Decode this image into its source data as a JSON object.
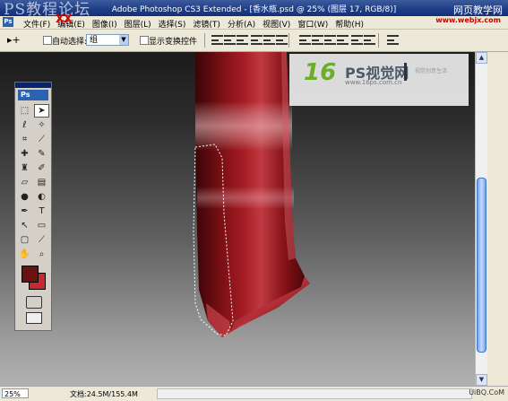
{
  "window": {
    "title": "Adobe Photoshop CS3 Extended - [香水瓶.psd @ 25% (图层 17, RGB/8)]",
    "watermark_left": "PS教程论坛",
    "watermark_right": "网页教学网",
    "minimize": "_",
    "restore": "❐",
    "close": "✕"
  },
  "menubar": {
    "items": [
      "文件(F)",
      "编辑(E)",
      "图像(I)",
      "图层(L)",
      "选择(S)",
      "滤镜(T)",
      "分析(A)",
      "视图(V)",
      "窗口(W)",
      "帮助(H)"
    ],
    "site": "www.webjx.com",
    "mark": "XX"
  },
  "options": {
    "tool_glyph": "▸+",
    "auto_select_label": "自动选择:",
    "auto_select_value": "组",
    "show_transform_label": "显示变换控件"
  },
  "logo": {
    "number": "16",
    "name": "PS视觉网",
    "url": "www.16ps.com.cn",
    "small": "视觉创意生活"
  },
  "tools": {
    "palette_label": "Ps",
    "items": [
      {
        "name": "marquee-icon",
        "glyph": "⬚"
      },
      {
        "name": "move-icon",
        "glyph": "➤"
      },
      {
        "name": "lasso-icon",
        "glyph": "ℓ"
      },
      {
        "name": "magic-wand-icon",
        "glyph": "✧"
      },
      {
        "name": "crop-icon",
        "glyph": "⌗"
      },
      {
        "name": "slice-icon",
        "glyph": "⟋"
      },
      {
        "name": "healing-icon",
        "glyph": "✚"
      },
      {
        "name": "brush-icon",
        "glyph": "✎"
      },
      {
        "name": "stamp-icon",
        "glyph": "♜"
      },
      {
        "name": "history-brush-icon",
        "glyph": "✐"
      },
      {
        "name": "eraser-icon",
        "glyph": "▱"
      },
      {
        "name": "gradient-icon",
        "glyph": "▤"
      },
      {
        "name": "blur-icon",
        "glyph": "●"
      },
      {
        "name": "dodge-icon",
        "glyph": "◐"
      },
      {
        "name": "pen-icon",
        "glyph": "✒"
      },
      {
        "name": "type-icon",
        "glyph": "T"
      },
      {
        "name": "path-select-icon",
        "glyph": "↖"
      },
      {
        "name": "shape-icon",
        "glyph": "▭"
      },
      {
        "name": "notes-icon",
        "glyph": "▢"
      },
      {
        "name": "eyedropper-icon",
        "glyph": "⟋"
      },
      {
        "name": "hand-icon",
        "glyph": "✋"
      },
      {
        "name": "zoom-icon",
        "glyph": "⌕"
      }
    ]
  },
  "colors": {
    "foreground": "#6a1313",
    "background": "#c8292c"
  },
  "status": {
    "zoom": "25%",
    "doc": "文档:24.5M/155.4M",
    "watermark": "UiBQ.CoM"
  }
}
